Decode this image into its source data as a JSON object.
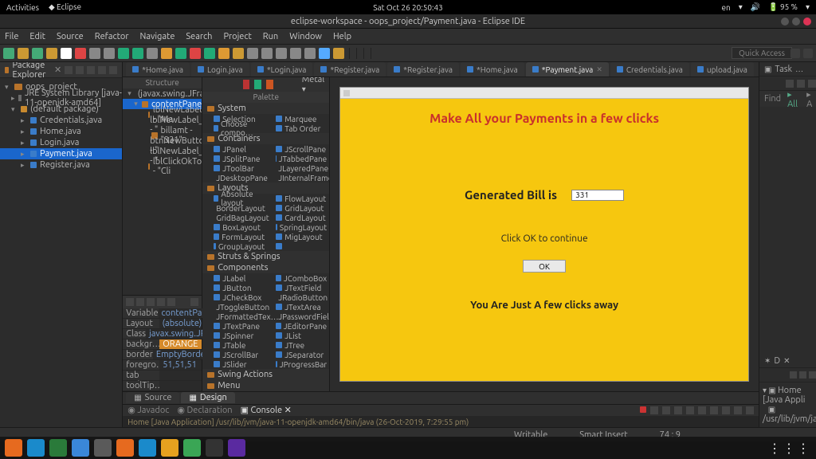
{
  "gnome": {
    "activities": "Activities",
    "app": "Eclipse",
    "clock": "Sat Oct 26 20:50:43",
    "battery": "95 %"
  },
  "title": "eclipse-workspace - oops_project/Payment.java - Eclipse IDE",
  "menu": [
    "File",
    "Edit",
    "Source",
    "Refactor",
    "Navigate",
    "Search",
    "Project",
    "Run",
    "Window",
    "Help"
  ],
  "quick_access": "Quick Access",
  "pkg_explorer": {
    "title": "Package Explorer",
    "items": [
      {
        "l": "oops_project",
        "d": 0,
        "t": "folder",
        "tw": "▾"
      },
      {
        "l": "JRE System Library [java-11-openjdk-amd64]",
        "d": 1,
        "t": "jar",
        "tw": "▸"
      },
      {
        "l": "(default package)",
        "d": 1,
        "t": "pkg",
        "tw": "▾"
      },
      {
        "l": "Credentials.java",
        "d": 2,
        "t": "java",
        "tw": "▸"
      },
      {
        "l": "Home.java",
        "d": 2,
        "t": "java",
        "tw": "▸"
      },
      {
        "l": "Login.java",
        "d": 2,
        "t": "java",
        "tw": "▸"
      },
      {
        "l": "Payment.java",
        "d": 2,
        "t": "java",
        "tw": "▸",
        "sel": true
      },
      {
        "l": "Register.java",
        "d": 2,
        "t": "java",
        "tw": "▸"
      }
    ]
  },
  "editor_tabs": [
    {
      "l": "*Home.java"
    },
    {
      "l": "Login.java"
    },
    {
      "l": "*Login.java"
    },
    {
      "l": "*Register.java"
    },
    {
      "l": "*Register.java"
    },
    {
      "l": "*Home.java"
    },
    {
      "l": "*Payment.java",
      "active": true
    },
    {
      "l": "Credentials.java"
    },
    {
      "l": "upload.java"
    }
  ],
  "right_tabs": [
    {
      "l": "Task"
    }
  ],
  "structure": {
    "title": "Structure",
    "items": [
      {
        "l": "(javax.swing.JFrame)",
        "d": 0,
        "tw": "▾"
      },
      {
        "l": "contentPane",
        "d": 1,
        "tw": "▾",
        "sel": true
      },
      {
        "l": "lblNewLabel - \"Ma",
        "d": 2
      },
      {
        "l": "lblNewLabel_1 - \"",
        "d": 2
      },
      {
        "l": "billamt - \"331\"",
        "d": 2
      },
      {
        "l": "btnNewButton - \"",
        "d": 2
      },
      {
        "l": "lblNewLabel_2 - \"",
        "d": 2
      },
      {
        "l": "lblClickOkTo - \"Cli",
        "d": 2
      }
    ]
  },
  "props": [
    {
      "k": "Variable",
      "v": "contentPane"
    },
    {
      "k": "Layout",
      "v": "(absolute)"
    },
    {
      "k": "Class",
      "v": "javax.swing.JP…"
    },
    {
      "k": "backgr…",
      "v": "ORANGE",
      "orange": true
    },
    {
      "k": "border",
      "v": "EmptyBorder…"
    },
    {
      "k": "foregro…",
      "v": "51,51,51"
    },
    {
      "k": "tab order",
      "v": ""
    },
    {
      "k": "toolTip…",
      "v": ""
    }
  ],
  "palette": {
    "title": "Palette",
    "metal": "Metal",
    "groups": [
      {
        "g": "System",
        "items": [
          {
            "l": "Selection"
          },
          {
            "l": "Marquee"
          },
          {
            "l": "Choose compo…"
          },
          {
            "l": "Tab Order"
          }
        ]
      },
      {
        "g": "Containers",
        "items": [
          {
            "l": "JPanel"
          },
          {
            "l": "JScrollPane"
          },
          {
            "l": "JSplitPane"
          },
          {
            "l": "JTabbedPane"
          },
          {
            "l": "JToolBar"
          },
          {
            "l": "JLayeredPane"
          },
          {
            "l": "JDesktopPane"
          },
          {
            "l": "JInternalFrame"
          }
        ]
      },
      {
        "g": "Layouts",
        "items": [
          {
            "l": "Absolute layout"
          },
          {
            "l": "FlowLayout"
          },
          {
            "l": "BorderLayout"
          },
          {
            "l": "GridLayout"
          },
          {
            "l": "GridBagLayout"
          },
          {
            "l": "CardLayout"
          },
          {
            "l": "BoxLayout"
          },
          {
            "l": "SpringLayout"
          },
          {
            "l": "FormLayout"
          },
          {
            "l": "MigLayout"
          },
          {
            "l": "GroupLayout"
          },
          {
            "l": ""
          }
        ]
      },
      {
        "g": "Struts & Springs",
        "items": []
      },
      {
        "g": "Components",
        "items": [
          {
            "l": "JLabel"
          },
          {
            "l": "JComboBox"
          },
          {
            "l": "JButton"
          },
          {
            "l": "JTextField"
          },
          {
            "l": "JCheckBox"
          },
          {
            "l": "JRadioButton"
          },
          {
            "l": "JToggleButton"
          },
          {
            "l": "JTextArea"
          },
          {
            "l": "JFormattedTex…"
          },
          {
            "l": "JPasswordField"
          },
          {
            "l": "JTextPane"
          },
          {
            "l": "JEditorPane"
          },
          {
            "l": "JSpinner"
          },
          {
            "l": "JList"
          },
          {
            "l": "JTable"
          },
          {
            "l": "JTree"
          },
          {
            "l": "JScrollBar"
          },
          {
            "l": "JSeparator"
          },
          {
            "l": "JSlider"
          },
          {
            "l": "JProgressBar"
          }
        ]
      },
      {
        "g": "Swing Actions",
        "items": []
      },
      {
        "g": "Menu",
        "items": []
      }
    ]
  },
  "form": {
    "title": "Make All your Payments in a few clicks",
    "bill_label": "Generated Bill is",
    "bill_value": "331",
    "continue": "Click OK to continue",
    "ok": "OK",
    "few": "You Are Just A few clicks away"
  },
  "sd_tabs": {
    "source": "Source",
    "design": "Design"
  },
  "console": {
    "javadoc": "Javadoc",
    "decl": "Declaration",
    "console": "Console"
  },
  "terminated": "Home [Java Application] /usr/lib/jvm/java-11-openjdk-amd64/bin/java (26-Oct-2019, 7:29:55 pm)",
  "right_panel": {
    "d": "D",
    "task": "Task",
    "find": "Find",
    "all": "All",
    "a": "A",
    "home": "Home [Java Appli",
    "path": "/usr/lib/jvm/ja"
  },
  "status": {
    "writable": "Writable",
    "insert": "Smart Insert",
    "pos": "74 : 9"
  },
  "dock_colors": [
    "#e66a1f",
    "#1a8acb",
    "#2a7a3a",
    "#3a87d9",
    "#5a5a5a",
    "#e66a1f",
    "#1a8acb",
    "#e6a11f",
    "#3aa655",
    "#333",
    "#5a2aa0"
  ]
}
